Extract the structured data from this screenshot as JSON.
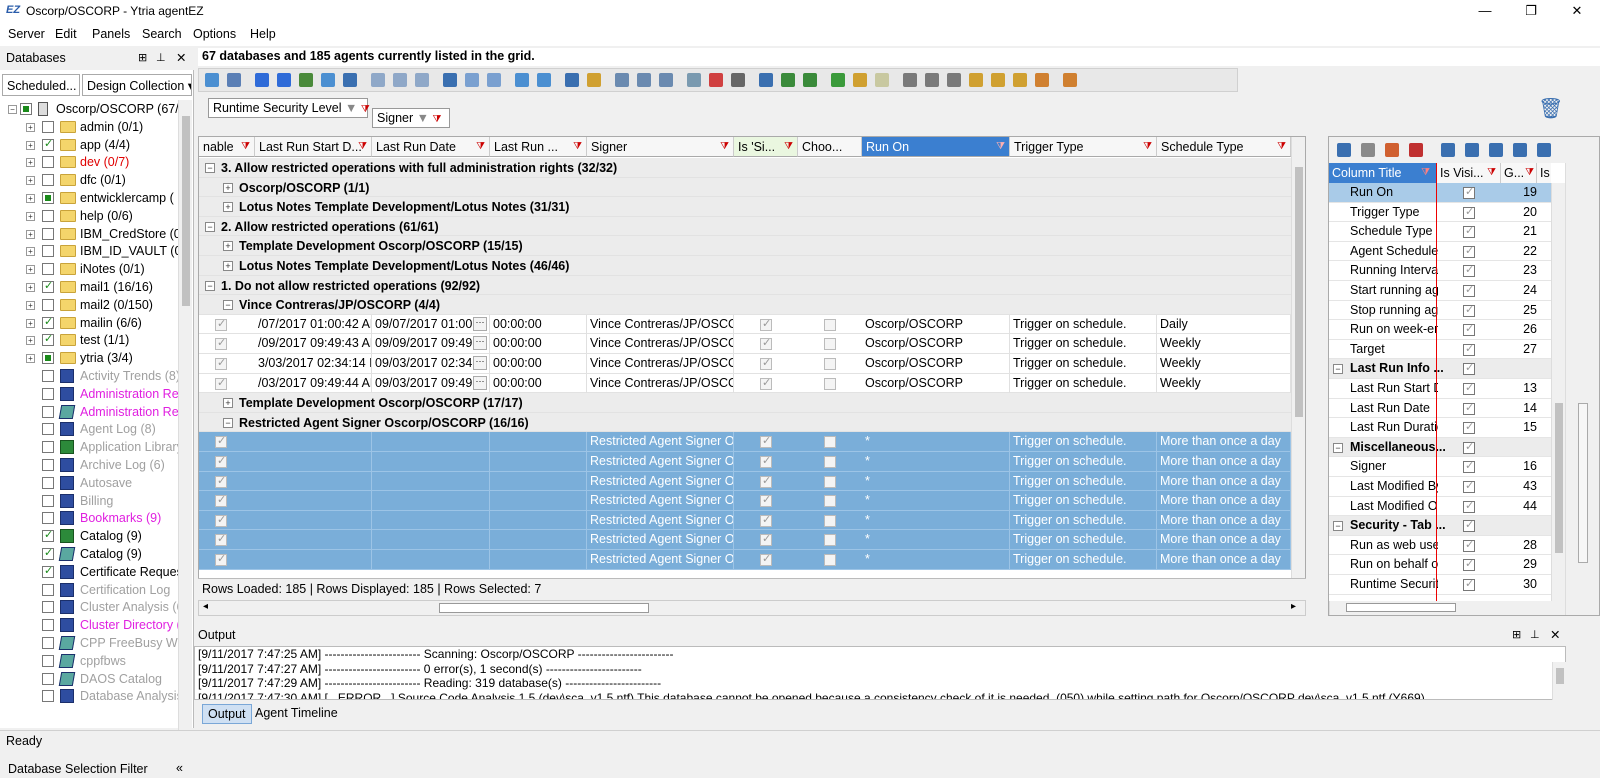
{
  "window": {
    "title": "Oscorp/OSCORP - Ytria agentEZ",
    "logo": "EZ",
    "minimize": "—",
    "maximize": "❐",
    "close": "✕"
  },
  "menu": [
    "Server",
    "Edit",
    "Panels",
    "Search",
    "Options",
    "Help"
  ],
  "left_panel": {
    "title": "Databases",
    "combo1": "Scheduled...",
    "combo2": "Design Collection",
    "footer": "Database Selection Filter",
    "tree": [
      {
        "label": "Oscorp/OSCORP  (67/",
        "color": "#000",
        "type": "server"
      },
      {
        "label": "admin  (0/1)",
        "color": "#000",
        "type": "folder",
        "check": "off"
      },
      {
        "label": "app  (4/4)",
        "color": "#000",
        "type": "folder",
        "check": "on"
      },
      {
        "label": "dev  (0/7)",
        "color": "#e00000",
        "type": "folder",
        "check": "off"
      },
      {
        "label": "dfc  (0/1)",
        "color": "#000",
        "type": "folder",
        "check": "off"
      },
      {
        "label": "entwicklercamp  (",
        "color": "#000",
        "type": "folder",
        "check": "sq"
      },
      {
        "label": "help  (0/6)",
        "color": "#000",
        "type": "folder",
        "check": "off"
      },
      {
        "label": "IBM_CredStore  (0/",
        "color": "#000",
        "type": "folder",
        "check": "off"
      },
      {
        "label": "IBM_ID_VAULT  (0/",
        "color": "#000",
        "type": "folder",
        "check": "off"
      },
      {
        "label": "iNotes  (0/1)",
        "color": "#000",
        "type": "folder",
        "check": "off"
      },
      {
        "label": "mail1  (16/16)",
        "color": "#000",
        "type": "folder",
        "check": "on"
      },
      {
        "label": "mail2  (0/150)",
        "color": "#000",
        "type": "folder",
        "check": "off"
      },
      {
        "label": "mailin  (6/6)",
        "color": "#000",
        "type": "folder",
        "check": "on"
      },
      {
        "label": "test  (1/1)",
        "color": "#000",
        "type": "folder",
        "check": "on"
      },
      {
        "label": "ytria  (3/4)",
        "color": "#000",
        "type": "folder",
        "check": "sq"
      },
      {
        "label": "Activity Trends (8)",
        "color": "#a0a0a0",
        "type": "db",
        "check": "off"
      },
      {
        "label": "Administration Req",
        "color": "#e020e0",
        "type": "db",
        "check": "off"
      },
      {
        "label": "Administration Req",
        "color": "#e020e0",
        "type": "dbc",
        "check": "off"
      },
      {
        "label": "Agent Log (8)",
        "color": "#a0a0a0",
        "type": "db",
        "check": "off"
      },
      {
        "label": "Application Library",
        "color": "#a0a0a0",
        "type": "dbg",
        "check": "off"
      },
      {
        "label": "Archive Log (6)",
        "color": "#a0a0a0",
        "type": "db",
        "check": "off"
      },
      {
        "label": "Autosave",
        "color": "#a0a0a0",
        "type": "db",
        "check": "off"
      },
      {
        "label": "Billing",
        "color": "#a0a0a0",
        "type": "db",
        "check": "off"
      },
      {
        "label": "Bookmarks (9)",
        "color": "#e020e0",
        "type": "db",
        "check": "off"
      },
      {
        "label": "Catalog (9)",
        "color": "#000",
        "type": "dbg",
        "check": "on"
      },
      {
        "label": "Catalog (9)",
        "color": "#000",
        "type": "dbc",
        "check": "on"
      },
      {
        "label": "Certificate Request",
        "color": "#000",
        "type": "db",
        "check": "on"
      },
      {
        "label": "Certification Log",
        "color": "#a0a0a0",
        "type": "db",
        "check": "off"
      },
      {
        "label": "Cluster Analysis (6",
        "color": "#a0a0a0",
        "type": "db",
        "check": "off"
      },
      {
        "label": "Cluster Directory (",
        "color": "#e020e0",
        "type": "db",
        "check": "off"
      },
      {
        "label": "CPP FreeBusy Web",
        "color": "#a0a0a0",
        "type": "dbc",
        "check": "off"
      },
      {
        "label": "cppfbws",
        "color": "#a0a0a0",
        "type": "dbc",
        "check": "off"
      },
      {
        "label": "DAOS Catalog",
        "color": "#a0a0a0",
        "type": "dbc",
        "check": "off"
      },
      {
        "label": "Database Analysis",
        "color": "#a0a0a0",
        "type": "db",
        "check": "off"
      }
    ]
  },
  "grid": {
    "summary": "67 databases and 185 agents currently listed in the grid.",
    "group_chips": [
      "Runtime Security Level",
      "Signer"
    ],
    "columns": [
      "nable",
      "Last Run Start D...",
      "Last Run Date",
      "Last Run ...",
      "Signer",
      "Is 'Si...",
      "Choo...",
      "Run On",
      "Trigger Type",
      "Schedule Type"
    ],
    "rows": [
      {
        "kind": "grp",
        "level": 0,
        "text": "3. Allow restricted operations with full administration rights (32/32)",
        "exp": "−"
      },
      {
        "kind": "grp",
        "level": 1,
        "text": "Oscorp/OSCORP (1/1)",
        "exp": "+"
      },
      {
        "kind": "grp",
        "level": 1,
        "text": "Lotus Notes Template Development/Lotus Notes (31/31)",
        "exp": "+"
      },
      {
        "kind": "grp",
        "level": 0,
        "text": "2. Allow restricted operations (61/61)",
        "exp": "−"
      },
      {
        "kind": "grp",
        "level": 1,
        "text": "Template Development Oscorp/OSCORP (15/15)",
        "exp": "+"
      },
      {
        "kind": "grp",
        "level": 1,
        "text": "Lotus Notes Template Development/Lotus Notes (46/46)",
        "exp": "+"
      },
      {
        "kind": "grp",
        "level": 0,
        "text": "1. Do not allow restricted operations (92/92)",
        "exp": "−"
      },
      {
        "kind": "grp",
        "level": 1,
        "text": "Vince Contreras/JP/OSCORP (4/4)",
        "exp": "−"
      },
      {
        "kind": "data",
        "start": "/07/2017 01:00:42 AM",
        "date": "09/07/2017 01:00...",
        "dur": "00:00:00",
        "signer": "Vince Contreras/JP/OSCORI",
        "runon": "Oscorp/OSCORP",
        "trigger": "Trigger on schedule.",
        "sched": "Daily"
      },
      {
        "kind": "data",
        "start": "/09/2017 09:49:43 AM",
        "date": "09/09/2017 09:49...",
        "dur": "00:00:00",
        "signer": "Vince Contreras/JP/OSCORI",
        "runon": "Oscorp/OSCORP",
        "trigger": "Trigger on schedule.",
        "sched": "Weekly"
      },
      {
        "kind": "data",
        "start": "3/03/2017 02:34:14 PM",
        "date": "09/03/2017 02:34...",
        "dur": "00:00:00",
        "signer": "Vince Contreras/JP/OSCORI",
        "runon": "Oscorp/OSCORP",
        "trigger": "Trigger on schedule.",
        "sched": "Weekly"
      },
      {
        "kind": "data",
        "start": "/03/2017 09:49:44 AM",
        "date": "09/03/2017 09:49...",
        "dur": "00:00:00",
        "signer": "Vince Contreras/JP/OSCORI",
        "runon": "Oscorp/OSCORP",
        "trigger": "Trigger on schedule.",
        "sched": "Weekly"
      },
      {
        "kind": "grp",
        "level": 1,
        "text": "Template Development Oscorp/OSCORP (17/17)",
        "exp": "+"
      },
      {
        "kind": "grp",
        "level": 1,
        "text": "Restricted Agent Signer Oscorp/OSCORP (16/16)",
        "exp": "−"
      },
      {
        "kind": "sel",
        "signer": "Restricted Agent Signer Osc",
        "runon": "*",
        "trigger": "Trigger on schedule.",
        "sched": "More than once a day"
      },
      {
        "kind": "sel",
        "signer": "Restricted Agent Signer Osc",
        "runon": "*",
        "trigger": "Trigger on schedule.",
        "sched": "More than once a day"
      },
      {
        "kind": "sel",
        "signer": "Restricted Agent Signer Osc",
        "runon": "*",
        "trigger": "Trigger on schedule.",
        "sched": "More than once a day"
      },
      {
        "kind": "sel",
        "signer": "Restricted Agent Signer Osc",
        "runon": "*",
        "trigger": "Trigger on schedule.",
        "sched": "More than once a day"
      },
      {
        "kind": "sel",
        "signer": "Restricted Agent Signer Osc",
        "runon": "*",
        "trigger": "Trigger on schedule.",
        "sched": "More than once a day"
      },
      {
        "kind": "sel",
        "signer": "Restricted Agent Signer Osc",
        "runon": "*",
        "trigger": "Trigger on schedule.",
        "sched": "More than once a day"
      },
      {
        "kind": "sel",
        "signer": "Restricted Agent Signer Osc",
        "runon": "*",
        "trigger": "Trigger on schedule.",
        "sched": "More than once a day"
      }
    ],
    "footer": "Rows Loaded: 185  |  Rows Displayed: 185  |  Rows Selected: 7"
  },
  "right_panel": {
    "headers": [
      "Column Title",
      "Is Visi...",
      "G...",
      "Is"
    ],
    "rows": [
      {
        "kind": "sel",
        "name": "Run On",
        "num": "19"
      },
      {
        "kind": "item",
        "name": "Trigger Type",
        "num": "20"
      },
      {
        "kind": "item",
        "name": "Schedule Type",
        "num": "21"
      },
      {
        "kind": "item",
        "name": "Agent Schedule",
        "num": "22"
      },
      {
        "kind": "item",
        "name": "Running Interva",
        "num": "23"
      },
      {
        "kind": "item",
        "name": "Start running ag",
        "num": "24"
      },
      {
        "kind": "item",
        "name": "Stop running ag",
        "num": "25"
      },
      {
        "kind": "item",
        "name": "Run on week-en",
        "num": "26"
      },
      {
        "kind": "item",
        "name": "Target",
        "num": "27"
      },
      {
        "kind": "grp",
        "name": "Last Run Info ...",
        "num": ""
      },
      {
        "kind": "item",
        "name": "Last Run Start Da",
        "num": "13"
      },
      {
        "kind": "item",
        "name": "Last Run Date",
        "num": "14"
      },
      {
        "kind": "item",
        "name": "Last Run Duratic",
        "num": "15"
      },
      {
        "kind": "grp",
        "name": "Miscellaneous...",
        "num": ""
      },
      {
        "kind": "item",
        "name": "Signer",
        "num": "16"
      },
      {
        "kind": "item",
        "name": "Last Modified By",
        "num": "43"
      },
      {
        "kind": "item",
        "name": "Last Modified O",
        "num": "44"
      },
      {
        "kind": "grp",
        "name": "Security - Tab ...",
        "num": ""
      },
      {
        "kind": "item",
        "name": "Run as web user",
        "num": "28"
      },
      {
        "kind": "item",
        "name": "Run on behalf o",
        "num": "29"
      },
      {
        "kind": "item",
        "name": "Runtime Securit",
        "num": "30"
      }
    ]
  },
  "output": {
    "title": "Output",
    "lines": [
      "[9/11/2017 7:47:25 AM] ------------------------ Scanning: Oscorp/OSCORP ------------------------",
      "[9/11/2017 7:47:27 AM] ------------------------ 0 error(s), 1 second(s) ------------------------",
      "[9/11/2017 7:47:29 AM] ------------------------ Reading: 319 database(s) ------------------------",
      "[9/11/2017 7:47:30 AM] [...ERROR...] Source Code Analysis 1.5 (dev\\sca_v1.5.ntf) This database cannot be opened because a consistency check of it is needed. (050) while setting path for Oscorp/OSCORP dev\\sca_v1.5.ntf (Y669)"
    ],
    "tabs": [
      "Output",
      "Agent Timeline"
    ]
  },
  "status": "Ready"
}
